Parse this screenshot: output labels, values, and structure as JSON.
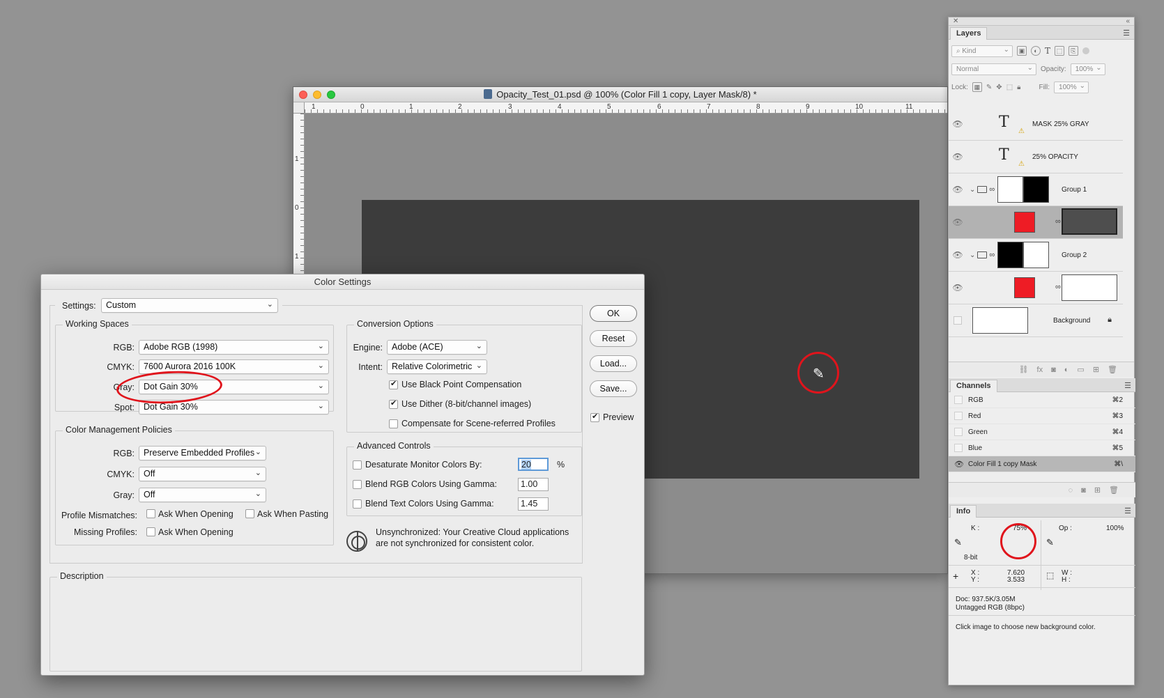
{
  "document": {
    "title": "Opacity_Test_01.psd @ 100% (Color Fill 1 copy, Layer Mask/8) *",
    "ruler_h": [
      "1",
      "0",
      "1",
      "2",
      "3",
      "4",
      "5",
      "6",
      "7",
      "8",
      "9",
      "10",
      "11"
    ],
    "ruler_v": [
      "1",
      "0",
      "1"
    ],
    "canvas_color": "#3c3c3c"
  },
  "layers_panel": {
    "tab": "Layers",
    "kind_filter": "Kind",
    "blend_mode": "Normal",
    "opacity_label": "Opacity:",
    "opacity_value": "100%",
    "lock_label": "Lock:",
    "fill_label": "Fill:",
    "fill_value": "100%",
    "layers": [
      {
        "name": "MASK 25% GRAY",
        "type": "text"
      },
      {
        "name": "25% OPACITY",
        "type": "text"
      },
      {
        "name": "Group 1",
        "type": "group"
      },
      {
        "name": "",
        "type": "fill",
        "selected": true
      },
      {
        "name": "Group 2",
        "type": "group"
      },
      {
        "name": "",
        "type": "fill"
      },
      {
        "name": "Background",
        "type": "background"
      }
    ]
  },
  "channels_panel": {
    "tab": "Channels",
    "channels": [
      {
        "name": "RGB",
        "shortcut": "⌘2"
      },
      {
        "name": "Red",
        "shortcut": "⌘3"
      },
      {
        "name": "Green",
        "shortcut": "⌘4"
      },
      {
        "name": "Blue",
        "shortcut": "⌘5"
      },
      {
        "name": "Color Fill 1 copy Mask",
        "shortcut": "⌘\\"
      }
    ]
  },
  "info_panel": {
    "tab": "Info",
    "k_label": "K :",
    "k_value": "75%",
    "op_label": "Op :",
    "op_value": "100%",
    "bitdepth": "8-bit",
    "x_label": "X :",
    "x_value": "7.620",
    "y_label": "Y :",
    "y_value": "3.533",
    "w_label": "W :",
    "h_label": "H :",
    "doc_size": "Doc: 937.5K/3.05M",
    "profile": "Untagged RGB (8bpc)",
    "hint": "Click image to choose new background color."
  },
  "color_settings": {
    "title": "Color Settings",
    "settings_label": "Settings:",
    "settings_value": "Custom",
    "working_spaces": {
      "title": "Working Spaces",
      "rgb_label": "RGB:",
      "rgb_value": "Adobe RGB (1998)",
      "cmyk_label": "CMYK:",
      "cmyk_value": "7600 Aurora 2016 100K",
      "gray_label": "Gray:",
      "gray_value": "Dot Gain 30%",
      "spot_label": "Spot:",
      "spot_value": "Dot Gain 30%"
    },
    "policies": {
      "title": "Color Management Policies",
      "rgb_label": "RGB:",
      "rgb_value": "Preserve Embedded Profiles",
      "cmyk_label": "CMYK:",
      "cmyk_value": "Off",
      "gray_label": "Gray:",
      "gray_value": "Off",
      "mismatch_label": "Profile Mismatches:",
      "ask_opening": "Ask When Opening",
      "ask_pasting": "Ask When Pasting",
      "missing_label": "Missing Profiles:",
      "missing_ask_opening": "Ask When Opening"
    },
    "conversion": {
      "title": "Conversion Options",
      "engine_label": "Engine:",
      "engine_value": "Adobe (ACE)",
      "intent_label": "Intent:",
      "intent_value": "Relative Colorimetric",
      "black_point": "Use Black Point Compensation",
      "dither": "Use Dither (8-bit/channel images)",
      "scene_referred": "Compensate for Scene-referred Profiles"
    },
    "advanced": {
      "title": "Advanced Controls",
      "desaturate": "Desaturate Monitor Colors By:",
      "desaturate_value": "20",
      "percent": "%",
      "blend_rgb": "Blend RGB Colors Using Gamma:",
      "blend_rgb_value": "1.00",
      "blend_text": "Blend Text Colors Using Gamma:",
      "blend_text_value": "1.45"
    },
    "sync_message": "Unsynchronized: Your Creative Cloud applications are not synchronized for consistent color.",
    "description_title": "Description",
    "buttons": {
      "ok": "OK",
      "reset": "Reset",
      "load": "Load...",
      "save": "Save..."
    },
    "preview_label": "Preview"
  },
  "colors": {
    "annotation_red": "#e0141c",
    "fill_red": "#ee1c25"
  }
}
